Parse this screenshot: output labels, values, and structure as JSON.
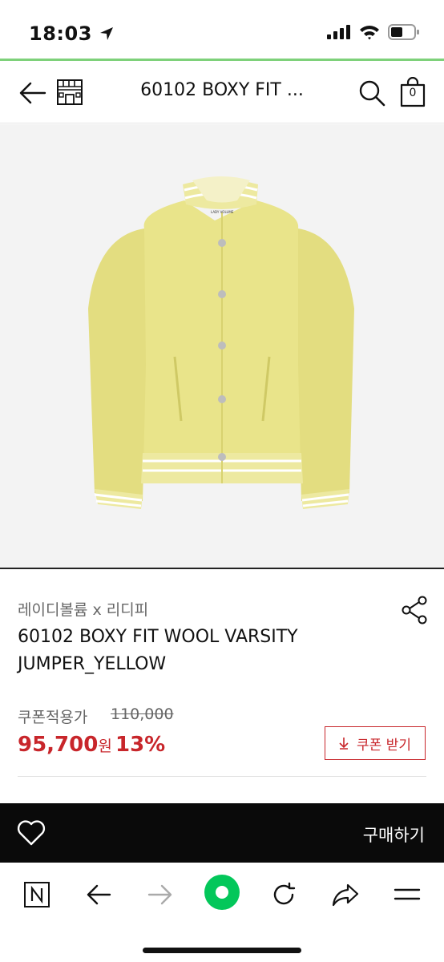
{
  "status": {
    "time": "18:03"
  },
  "header": {
    "title": "60102 BOXY FIT ...",
    "bag_count": "0"
  },
  "product": {
    "brand": "레이디볼륨 x 리디피",
    "name": "60102 BOXY FIT WOOL VARSITY JUMPER_YELLOW",
    "coupon_label": "쿠폰적용가",
    "original_price": "110,000",
    "sale_price": "95,700",
    "currency": "원",
    "discount": "13%",
    "coupon_button": "쿠폰 받기",
    "image_label": "LADY VOLUME"
  },
  "buy_bar": {
    "buy_label": "구매하기"
  },
  "colors": {
    "accent": "#c8262b",
    "jacket": "#e9e48a",
    "status_green": "#7ed17a",
    "browser_green": "#03c75a"
  },
  "icons": [
    "location-arrow-icon",
    "signal-icon",
    "wifi-icon",
    "battery-icon",
    "back-arrow-icon",
    "store-icon",
    "search-icon",
    "shopping-bag-icon",
    "share-icon",
    "heart-icon",
    "naver-icon",
    "forward-icon",
    "green-dot-icon",
    "reload-icon",
    "menu-icon"
  ]
}
